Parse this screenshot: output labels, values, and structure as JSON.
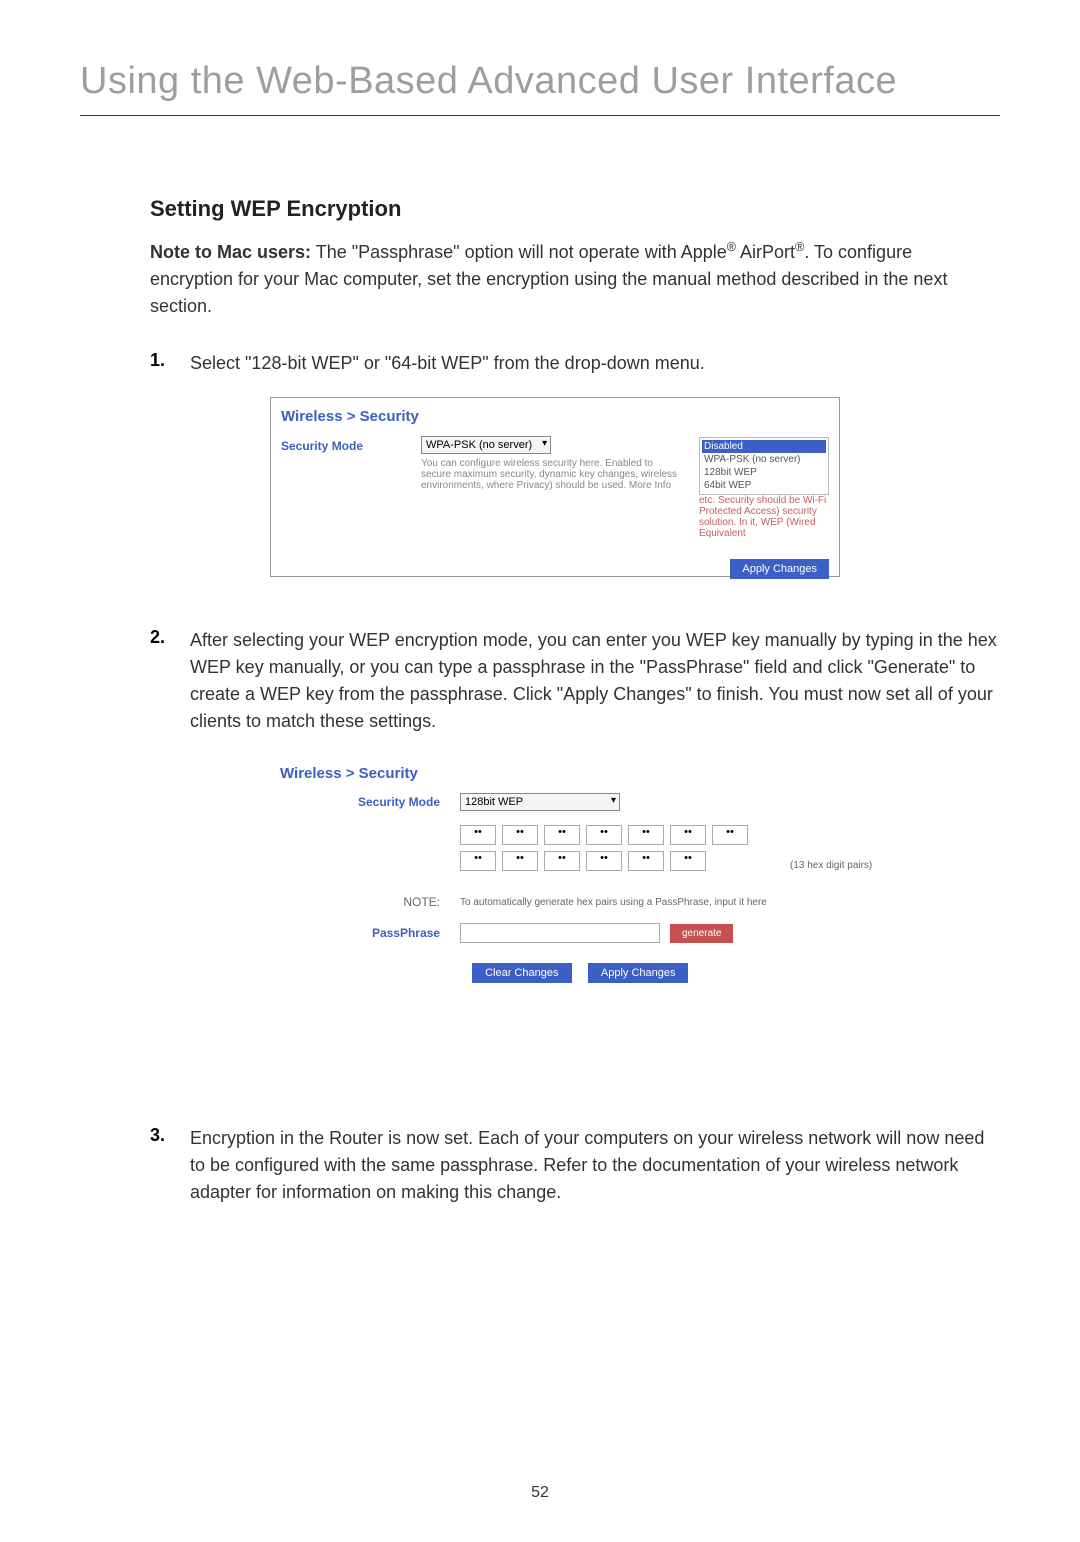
{
  "chapter_title": "Using the Web-Based Advanced User Interface",
  "section_heading": "Setting WEP Encryption",
  "note": {
    "label": "Note to Mac users:",
    "text_part1": " The \"Passphrase\" option will not operate with Apple",
    "text_part2": " AirPort",
    "text_part3": ". To configure encryption for your Mac computer, set the encryption using the manual method described in the next section.",
    "reg": "®"
  },
  "steps": [
    {
      "number": "1.",
      "text": "Select \"128-bit WEP\" or \"64-bit WEP\" from the drop-down menu."
    },
    {
      "number": "2.",
      "text": "After selecting your WEP encryption mode, you can enter you WEP key manually by typing in the hex WEP key manually, or you can type a passphrase in the \"PassPhrase\" field and click \"Generate\" to create a WEP key from the passphrase. Click \"Apply Changes\" to finish. You must now set all of your clients to match these settings."
    },
    {
      "number": "3.",
      "text": "Encryption in the Router is now set. Each of your computers on your wireless network will now need to be configured with the same passphrase. Refer to the documentation of your wireless network adapter for information on making this change."
    }
  ],
  "screenshot1": {
    "breadcrumb": "Wireless > Security",
    "label_security_mode": "Security Mode",
    "dropdown_selected": "WPA-PSK (no server)",
    "options": [
      "Disabled",
      "WPA-PSK (no server)",
      "128bit WEP",
      "64bit WEP"
    ],
    "description_left": "You can configure wireless security here. Enabled to secure maximum security, dynamic key changes, wireless environments, where Privacy) should be used. More Info",
    "description_right": "etc. Security should be Wi-Fi Protected Access) security solution. In it, WEP (Wired Equivalent",
    "apply_button": "Apply Changes"
  },
  "screenshot2": {
    "breadcrumb": "Wireless > Security",
    "label_security_mode": "Security Mode",
    "dropdown_selected": "128bit WEP",
    "hex_values": [
      "••",
      "••",
      "••",
      "••",
      "••",
      "••",
      "••",
      "••",
      "••",
      "••",
      "••",
      "••",
      "••"
    ],
    "hex_note": "(13 hex digit pairs)",
    "note_label": "NOTE:",
    "note_text": "To automatically generate hex pairs using a PassPhrase, input it here",
    "passphrase_label": "PassPhrase",
    "generate_button": "generate",
    "clear_button": "Clear Changes",
    "apply_button": "Apply Changes"
  },
  "page_number": "52"
}
